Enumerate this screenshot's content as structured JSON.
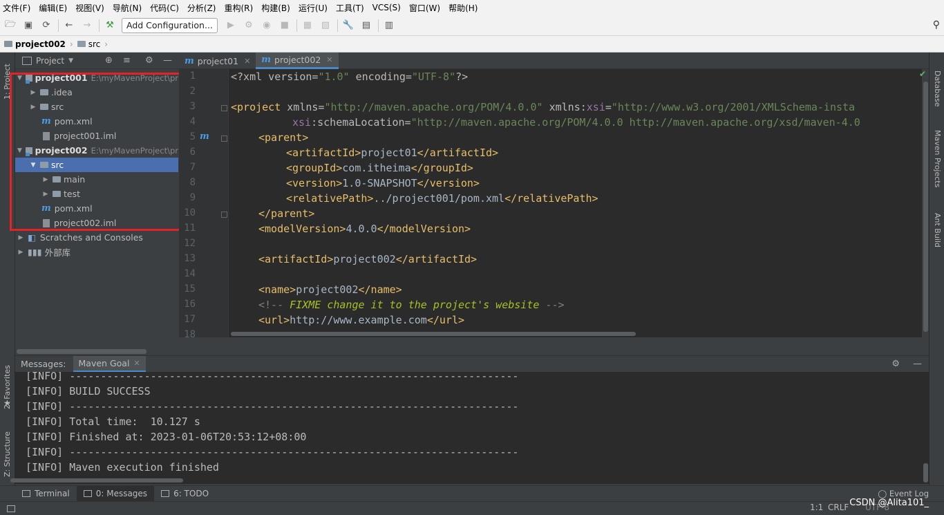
{
  "menu": [
    "文件(F)",
    "编辑(E)",
    "视图(V)",
    "导航(N)",
    "代码(C)",
    "分析(Z)",
    "重构(R)",
    "构建(B)",
    "运行(U)",
    "工具(T)",
    "VCS(S)",
    "窗口(W)",
    "帮助(H)"
  ],
  "toolbar": {
    "add_config": "Add Configuration..."
  },
  "breadcrumb": {
    "project": "project002",
    "folder": "src"
  },
  "left_strip": {
    "project": "1: Project",
    "favorites": "2: Favorites",
    "structure": "Z: Structure"
  },
  "right_strip": {
    "database": "Database",
    "maven": "Maven Projects",
    "ant": "Ant Build"
  },
  "project_panel": {
    "title": "Project",
    "p1": {
      "name": "project001",
      "path": "E:\\myMavenProject\\pr"
    },
    "idea": ".idea",
    "src1": "src",
    "pom1": "pom.xml",
    "iml1": "project001.iml",
    "p2": {
      "name": "project002",
      "path": "E:\\myMavenProject\\pr"
    },
    "src2": "src",
    "main": "main",
    "test": "test",
    "pom2": "pom.xml",
    "iml2": "project002.iml",
    "scratches": "Scratches and Consoles",
    "external": "外部库"
  },
  "tabs": [
    {
      "label": "project01"
    },
    {
      "label": "project002"
    }
  ],
  "editor": {
    "line_numbers": [
      "1",
      "2",
      "3",
      "4",
      "5",
      "6",
      "7",
      "8",
      "9",
      "10",
      "11",
      "12",
      "13",
      "14",
      "15",
      "16",
      "17",
      "18"
    ],
    "l1": {
      "a": "<?xml version=",
      "b": "\"1.0\"",
      "c": " encoding=",
      "d": "\"UTF-8\"",
      "e": "?>"
    },
    "l3": {
      "a": "<project",
      "b": " xmlns=",
      "c": "\"http://maven.apache.org/POM/4.0.0\"",
      "d": " xmlns:",
      "e": "xsi",
      "f": "=",
      "g": "\"http://www.w3.org/2001/XMLSchema-insta"
    },
    "l4": {
      "a": "xsi",
      "b": ":schemaLocation=",
      "c": "\"http://maven.apache.org/POM/4.0.0 http://maven.apache.org/xsd/maven-4.0"
    },
    "l5": "<parent>",
    "l6": {
      "o": "<artifactId>",
      "v": "project01",
      "c": "</artifactId>"
    },
    "l7": {
      "o": "<groupId>",
      "v": "com.itheima",
      "c": "</groupId>"
    },
    "l8": {
      "o": "<version>",
      "v": "1.0-SNAPSHOT",
      "c": "</version>"
    },
    "l9": {
      "o": "<relativePath>",
      "v": "../project001/pom.xml",
      "c": "</relativePath>"
    },
    "l10": "</parent>",
    "l11": {
      "o": "<modelVersion>",
      "v": "4.0.0",
      "c": "</modelVersion>"
    },
    "l13": {
      "o": "<artifactId>",
      "v": "project002",
      "c": "</artifactId>"
    },
    "l15": {
      "o": "<name>",
      "v": "project002",
      "c": "</name>"
    },
    "l16": {
      "a": "<!-- ",
      "b": "FIXME change it to the project's website",
      "c": " -->"
    },
    "l17": {
      "o": "<url>",
      "v": "http://www.example.com",
      "c": "</url>"
    }
  },
  "messages": {
    "title": "Messages:",
    "tab": "Maven Goal"
  },
  "console_lines": [
    "[INFO] ------------------------------------------------------------------------",
    "[INFO] BUILD SUCCESS",
    "[INFO] ------------------------------------------------------------------------",
    "[INFO] Total time:  10.127 s",
    "[INFO] Finished at: 2023-01-06T20:53:12+08:00",
    "[INFO] ------------------------------------------------------------------------",
    "[INFO] Maven execution finished"
  ],
  "bottom_tabs": {
    "terminal": "Terminal",
    "messages": "0: Messages",
    "todo": "6: TODO"
  },
  "status": {
    "event_log": "Event Log",
    "position": "1:1",
    "line_sep": "CRLF",
    "encoding": "UTF-8",
    "watermark": "CSDN @Alita101_"
  }
}
